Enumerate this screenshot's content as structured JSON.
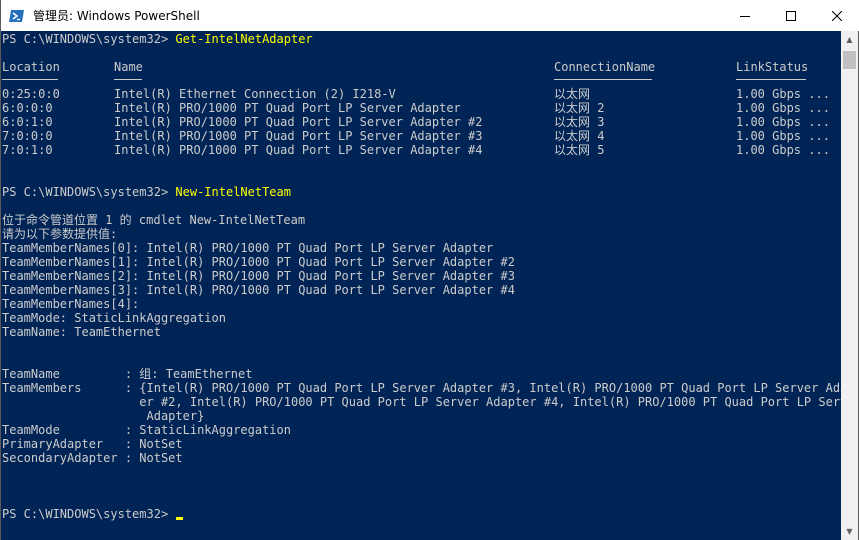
{
  "window": {
    "title": "管理员: Windows PowerShell",
    "minimize_label": "minimize",
    "maximize_label": "maximize",
    "close_label": "close"
  },
  "colors": {
    "console_bg": "#012456",
    "text": "#cccccc",
    "command": "#ffff00"
  },
  "session": {
    "prompt": "PS C:\\WINDOWS\\system32> ",
    "command1": "Get-IntelNetAdapter",
    "adapters_table": {
      "headers": [
        "Location",
        "Name",
        "ConnectionName",
        "LinkStatus"
      ],
      "rows": [
        [
          "0:25:0:0",
          "Intel(R) Ethernet Connection (2) I218-V",
          "以太网",
          "1.00 Gbps ..."
        ],
        [
          "6:0:0:0",
          "Intel(R) PRO/1000 PT Quad Port LP Server Adapter",
          "以太网 2",
          "1.00 Gbps ..."
        ],
        [
          "6:0:1:0",
          "Intel(R) PRO/1000 PT Quad Port LP Server Adapter #2",
          "以太网 3",
          "1.00 Gbps ..."
        ],
        [
          "7:0:0:0",
          "Intel(R) PRO/1000 PT Quad Port LP Server Adapter #3",
          "以太网 4",
          "1.00 Gbps ..."
        ],
        [
          "7:0:1:0",
          "Intel(R) PRO/1000 PT Quad Port LP Server Adapter #4",
          "以太网 5",
          "1.00 Gbps ..."
        ]
      ]
    },
    "command2": "New-IntelNetTeam",
    "param_prompt_1": "位于命令管道位置 1 的 cmdlet New-IntelNetTeam",
    "param_prompt_2": "请为以下参数提供值:",
    "param_lines": [
      "TeamMemberNames[0]: Intel(R) PRO/1000 PT Quad Port LP Server Adapter",
      "TeamMemberNames[1]: Intel(R) PRO/1000 PT Quad Port LP Server Adapter #2",
      "TeamMemberNames[2]: Intel(R) PRO/1000 PT Quad Port LP Server Adapter #3",
      "TeamMemberNames[3]: Intel(R) PRO/1000 PT Quad Port LP Server Adapter #4",
      "TeamMemberNames[4]:",
      "TeamMode: StaticLinkAggregation",
      "TeamName: TeamEthernet"
    ],
    "result_lines": [
      "TeamName         : 组: TeamEthernet",
      "TeamMembers      : {Intel(R) PRO/1000 PT Quad Port LP Server Adapter #3, Intel(R) PRO/1000 PT Quad Port LP Server Adapt",
      "                   er #2, Intel(R) PRO/1000 PT Quad Port LP Server Adapter #4, Intel(R) PRO/1000 PT Quad Port LP Server",
      "                    Adapter}",
      "TeamMode         : StaticLinkAggregation",
      "PrimaryAdapter   : NotSet",
      "SecondaryAdapter : NotSet"
    ]
  }
}
